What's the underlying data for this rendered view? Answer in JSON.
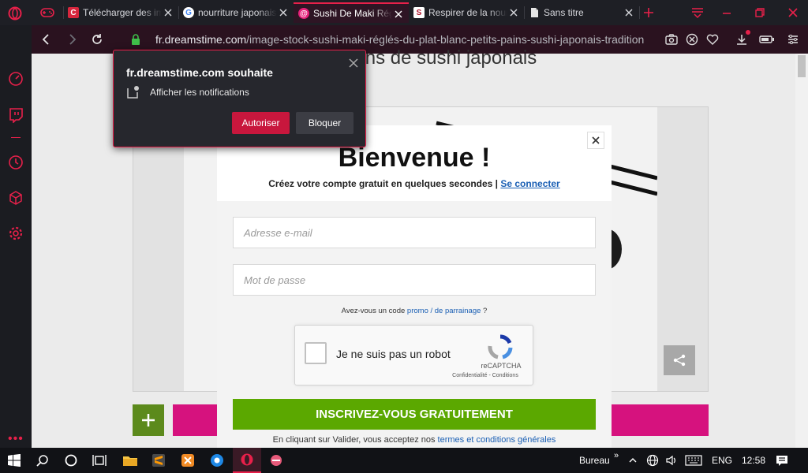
{
  "tabs": [
    {
      "title": "Télécharger des images",
      "favicon": "C"
    },
    {
      "title": "nourriture japonaise",
      "favicon": "G"
    },
    {
      "title": "Sushi De Maki Réglés",
      "favicon": "@"
    },
    {
      "title": "Respirer de la nourriture",
      "favicon": "S"
    },
    {
      "title": "Sans titre",
      "favicon": "doc-icon"
    }
  ],
  "address_bar": {
    "domain": "fr.dreamstime.com",
    "path": "/image-stock-sushi-maki-réglés-du-plat-blanc-petits-pains-sushi-japonais-tradition"
  },
  "page": {
    "heading_partial": "t blanc. Petits pains de sushi japonais"
  },
  "notification": {
    "site": "fr.dreamstime.com souhaite",
    "permission": "Afficher les notifications",
    "allow_label": "Autoriser",
    "block_label": "Bloquer"
  },
  "modal": {
    "title": "Bienvenue !",
    "subtitle": "Créez votre compte gratuit en quelques secondes |",
    "login_link": "Se connecter",
    "email_placeholder": "Adresse e-mail",
    "password_placeholder": "Mot de passe",
    "promo_prefix": "Avez-vous un code",
    "promo_link": "promo / de parrainage",
    "promo_suffix": "?",
    "captcha_label": "Je ne suis pas un robot",
    "captcha_brand": "reCAPTCHA",
    "captcha_links": "Confidentialité - Conditions",
    "signup_button": "INSCRIVEZ-VOUS GRATUITEMENT",
    "terms_prefix": "En cliquant sur Valider, vous acceptez nos",
    "terms_link": "termes et conditions générales"
  },
  "taskbar": {
    "desktop_label": "Bureau",
    "language": "ENG",
    "time": "12:58"
  },
  "colors": {
    "accent": "#e8204a",
    "signup_green": "#5ba800",
    "link_blue": "#1a5fb4",
    "pink_bar": "#d6127e",
    "green_plus": "#5c8a1c"
  }
}
